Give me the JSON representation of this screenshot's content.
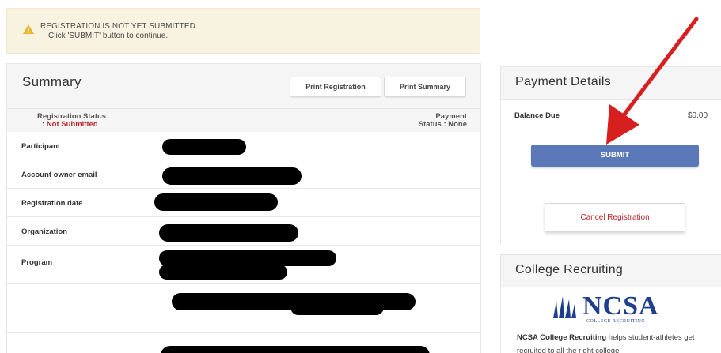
{
  "alert": {
    "line1": "REGISTRATION IS NOT YET SUBMITTED.",
    "line2": "Click 'SUBMIT' button to continue."
  },
  "summary": {
    "title": "Summary",
    "print_registration": "Print Registration",
    "print_summary": "Print Summary",
    "registration_status_label": "Registration Status",
    "registration_status_prefix": ": ",
    "registration_status_value": "Not Submitted",
    "payment_status_line1": "Payment",
    "payment_status_line2": "Status : None",
    "rows": [
      {
        "label": "Participant"
      },
      {
        "label": "Account owner email"
      },
      {
        "label": "Registration date"
      },
      {
        "label": "Organization"
      },
      {
        "label": "Program"
      },
      {
        "label": ""
      },
      {
        "label": ""
      }
    ]
  },
  "payment": {
    "title": "Payment Details",
    "balance_label": "Balance Due",
    "balance_value": "$0.00",
    "submit_label": "SUBMIT",
    "cancel_label": "Cancel Registration"
  },
  "college": {
    "title": "College Recruiting",
    "logo_text": "NCSA",
    "logo_subtext": "COLLEGE RECRUITING",
    "desc_bold": "NCSA College Recruiting",
    "desc_rest": " helps student-athletes get recruited to all the right college"
  },
  "colors": {
    "alert_bg": "#f8f2e0",
    "submit_bg": "#5b79b9",
    "status_red": "#c0262c",
    "ncsa_blue": "#1e3f8f",
    "annotation_arrow": "#d81f1f"
  },
  "icons": {
    "alert_icon": "warning-triangle-icon",
    "logo_mark": "ncsa-lines-icon"
  }
}
